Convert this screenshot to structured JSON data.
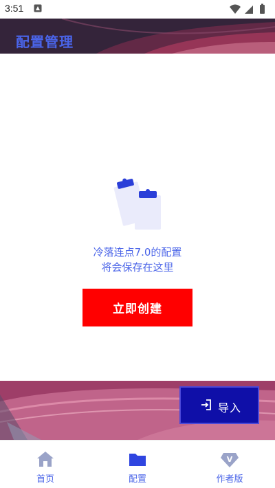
{
  "status_bar": {
    "time": "3:51"
  },
  "header": {
    "title": "配置管理"
  },
  "empty_state": {
    "line1": "冷落连点7.0的配置",
    "line2": "将会保存在这里",
    "illustration_icon": "clipboard-icon"
  },
  "actions": {
    "create_label": "立即创建",
    "import_label": "导入",
    "import_icon": "login-arrow-icon"
  },
  "nav": {
    "items": [
      {
        "label": "首页",
        "icon": "home-icon"
      },
      {
        "label": "配置",
        "icon": "folder-icon"
      },
      {
        "label": "作者版",
        "icon": "v-badge-icon"
      }
    ]
  },
  "colors": {
    "accent": "#4a64e8",
    "create_button": "#ff0000",
    "import_button": "#0f0fa8",
    "header_bg": "#3a2a3f",
    "band_bg": "#b8577e"
  }
}
